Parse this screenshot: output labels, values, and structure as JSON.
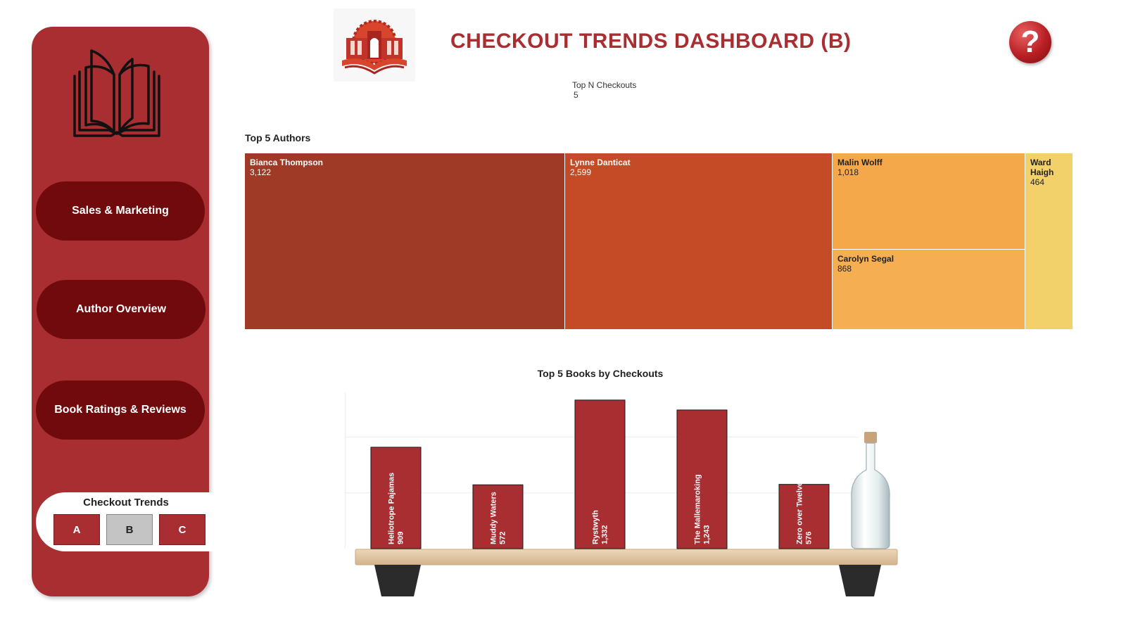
{
  "sidebar": {
    "nav": [
      {
        "label": "Sales & Marketing"
      },
      {
        "label": "Author Overview"
      },
      {
        "label": "Book Ratings & Reviews"
      }
    ],
    "checkout_trends": {
      "title": "Checkout Trends",
      "options": [
        "A",
        "B",
        "C"
      ],
      "selected": "B"
    }
  },
  "header": {
    "title": "CHECKOUT TRENDS DASHBOARD (B)",
    "help_label": "?"
  },
  "parameter": {
    "label": "Top N Checkouts",
    "value": "5"
  },
  "colors": {
    "brand": "#a82e32",
    "nav_button": "#700a0c",
    "treemap": [
      "#9e3a26",
      "#c44b25",
      "#f5a84a",
      "#f5ae52",
      "#f2d06a"
    ]
  },
  "treemap": {
    "title": "Top 5 Authors",
    "items": [
      {
        "name": "Bianca Thompson",
        "value_label": "3,122",
        "value": 3122
      },
      {
        "name": "Lynne Danticat",
        "value_label": "2,599",
        "value": 2599
      },
      {
        "name": "Malin Wolff",
        "value_label": "1,018",
        "value": 1018
      },
      {
        "name": "Carolyn Segal",
        "value_label": "868",
        "value": 868
      },
      {
        "name": "Ward Haigh",
        "value_label": "464",
        "value": 464
      }
    ]
  },
  "chart_data": {
    "type": "bar",
    "title": "Top 5 Books by Checkouts",
    "categories": [
      "Heliotrope Pajamas",
      "Muddy Waters",
      "Rystwyth",
      "The Mallemaroking",
      "Zero over Twelve"
    ],
    "values": [
      909,
      572,
      1332,
      1243,
      576
    ],
    "value_labels": [
      "909",
      "572",
      "1,332",
      "1,243",
      "576"
    ],
    "xlabel": "",
    "ylabel": "",
    "ylim": [
      0,
      1400
    ],
    "grid": true
  }
}
